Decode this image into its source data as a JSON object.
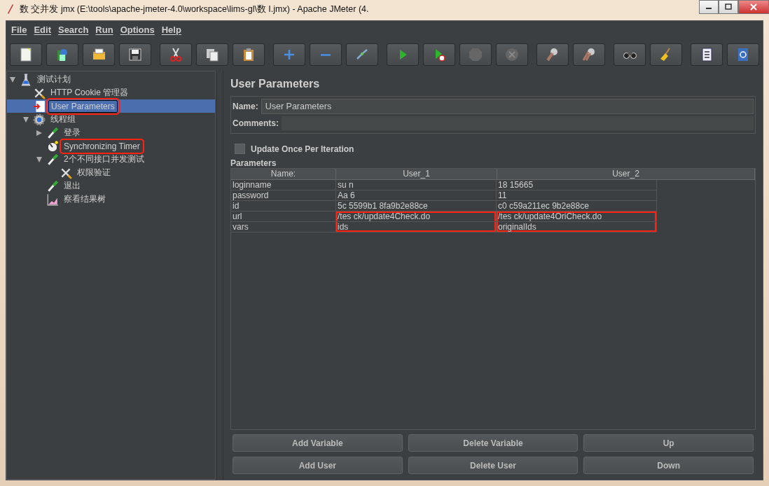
{
  "window": {
    "title": "数 交并发 jmx (E:\\tools\\apache-jmeter-4.0\\workspace\\lims-gl\\数 I.jmx) - Apache JMeter (4."
  },
  "menu": [
    "File",
    "Edit",
    "Search",
    "Run",
    "Options",
    "Help"
  ],
  "toolbar": [
    {
      "kind": "new"
    },
    {
      "kind": "templates"
    },
    {
      "kind": "open"
    },
    {
      "kind": "save"
    },
    {
      "kind": "sep"
    },
    {
      "kind": "cut"
    },
    {
      "kind": "copy"
    },
    {
      "kind": "paste"
    },
    {
      "kind": "sep"
    },
    {
      "kind": "expand"
    },
    {
      "kind": "collapse"
    },
    {
      "kind": "toggle"
    },
    {
      "kind": "sep"
    },
    {
      "kind": "start"
    },
    {
      "kind": "start-no-pause"
    },
    {
      "kind": "stop"
    },
    {
      "kind": "shutdown"
    },
    {
      "kind": "sep"
    },
    {
      "kind": "clear"
    },
    {
      "kind": "clear-all"
    },
    {
      "kind": "sep"
    },
    {
      "kind": "search"
    },
    {
      "kind": "reset"
    },
    {
      "kind": "sep"
    },
    {
      "kind": "functions"
    },
    {
      "kind": "help"
    }
  ],
  "tree": [
    {
      "label": "测试计划",
      "kind": "plan",
      "expanded": true,
      "selected": false,
      "highlighted": false,
      "children": [
        {
          "label": "HTTP Cookie 管理器",
          "kind": "config",
          "selected": false,
          "highlighted": false
        },
        {
          "label": "User Parameters",
          "kind": "preprocessor",
          "selected": true,
          "highlighted": true
        },
        {
          "label": "线程组",
          "kind": "threads",
          "expanded": true,
          "selected": false,
          "highlighted": false,
          "children": [
            {
              "label": "登录",
              "kind": "sampler",
              "expanded": false,
              "selected": false,
              "highlighted": false
            },
            {
              "label": "Synchronizing Timer",
              "kind": "timer",
              "selected": false,
              "highlighted": true
            },
            {
              "label": "2个不同接口并发测试",
              "kind": "sampler",
              "expanded": true,
              "selected": false,
              "highlighted": false,
              "children": [
                {
                  "label": "权限验证",
                  "kind": "config",
                  "selected": false,
                  "highlighted": false
                }
              ]
            },
            {
              "label": "退出",
              "kind": "sampler",
              "selected": false,
              "highlighted": false
            },
            {
              "label": "察看结果树",
              "kind": "listener",
              "selected": false,
              "highlighted": false
            }
          ]
        }
      ]
    }
  ],
  "panel": {
    "title": "User Parameters",
    "name_label": "Name:",
    "name_value": "User Parameters",
    "comments_label": "Comments:",
    "update_once": {
      "label": "Update Once Per Iteration",
      "checked": false
    },
    "parameters_label": "Parameters",
    "table": {
      "columns": [
        "Name:",
        "User_1",
        "User_2"
      ],
      "rows": [
        [
          {
            "text": "loginname"
          },
          {
            "text": "su n",
            "highlighted": false
          },
          {
            "text": "18 15665",
            "highlighted": false
          }
        ],
        [
          {
            "text": "password"
          },
          {
            "text": "Aa 6",
            "highlighted": false
          },
          {
            "text": "11",
            "highlighted": false
          }
        ],
        [
          {
            "text": "id"
          },
          {
            "text": "5c 5599b1 8fa9b2e88ce",
            "highlighted": false
          },
          {
            "text": "c0 c59a211ec 9b2e88ce",
            "highlighted": false
          }
        ],
        [
          {
            "text": "url"
          },
          {
            "text": "/tes ck/update4Check.do",
            "highlighted": true
          },
          {
            "text": "/tes ck/update4OriCheck.do",
            "highlighted": true
          }
        ],
        [
          {
            "text": "vars"
          },
          {
            "text": "ids",
            "highlighted": true
          },
          {
            "text": "originalIds",
            "highlighted": true
          }
        ]
      ]
    },
    "buttons": [
      "Add Variable",
      "Delete Variable",
      "Up",
      "Add User",
      "Delete User",
      "Down"
    ]
  }
}
